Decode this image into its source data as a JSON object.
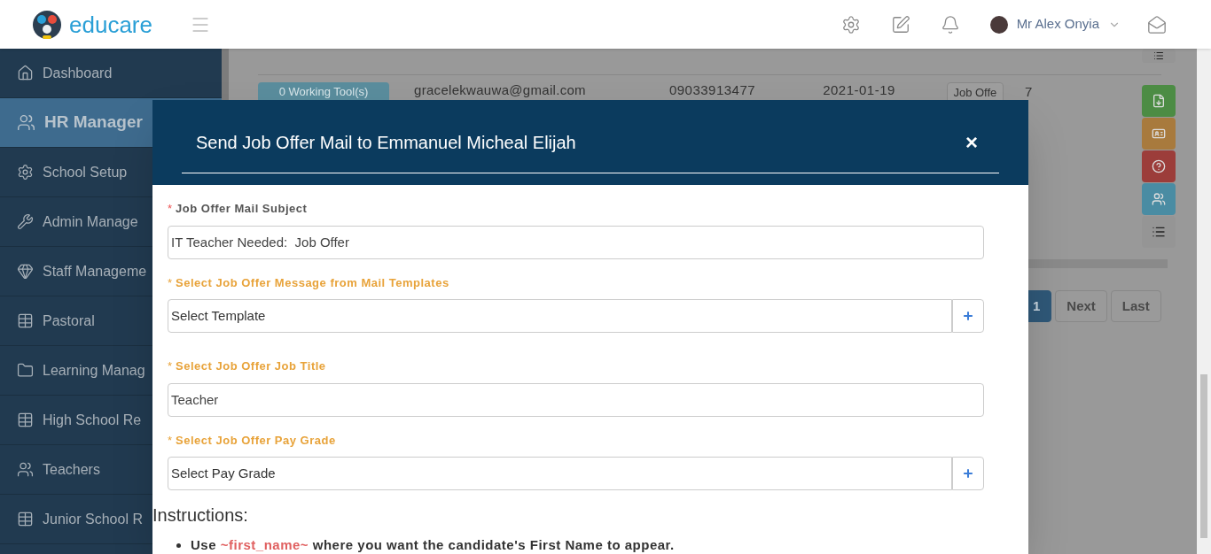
{
  "header": {
    "brand": "educare",
    "user": "Mr Alex Onyia"
  },
  "sidebar": {
    "items": [
      {
        "label": "Dashboard",
        "kind": "home",
        "selected": false
      },
      {
        "label": "HR Manager",
        "kind": "users",
        "selected": true
      },
      {
        "label": "School Setup",
        "kind": "gear",
        "selected": false
      },
      {
        "label": "Admin Manage",
        "kind": "wrench",
        "selected": false
      },
      {
        "label": "Staff Manageme",
        "kind": "diamond",
        "selected": false
      },
      {
        "label": "Pastoral",
        "kind": "grid",
        "selected": false
      },
      {
        "label": "Learning Manag",
        "kind": "folder",
        "selected": false
      },
      {
        "label": "High School Re",
        "kind": "grid",
        "selected": false
      },
      {
        "label": "Teachers",
        "kind": "users",
        "selected": false
      },
      {
        "label": "Junior School R",
        "kind": "grid",
        "selected": false
      }
    ]
  },
  "table_row": {
    "tools": "0 Working Tool(s)",
    "email": "gracelekwauwa@gmail.com",
    "phone": "09033913477",
    "date": "2021-01-19",
    "action": "Job Offe",
    "count": "7"
  },
  "side_actions": [
    {
      "kind": "list"
    },
    {
      "kind": "file",
      "color": "#4c8c44"
    },
    {
      "kind": "card",
      "color": "#a87a3d"
    },
    {
      "kind": "question",
      "color": "#9c3d3a"
    },
    {
      "kind": "users",
      "color": "#4a8ca3"
    },
    {
      "kind": "list"
    }
  ],
  "pagination": [
    {
      "label": "1",
      "selected": true
    },
    {
      "label": "Next",
      "selected": false
    },
    {
      "label": "Last",
      "selected": false
    }
  ],
  "modal": {
    "title": "Send Job Offer Mail to Emmanuel Micheal Elijah",
    "close": "×",
    "fields": [
      {
        "marker": "*",
        "label": "Job Offer Mail Subject",
        "highlighted": false,
        "kind": "input",
        "value": "IT Teacher Needed:  Job Offer"
      },
      {
        "marker": "*",
        "label": "Select Job Offer Message from Mail Templates",
        "highlighted": true,
        "kind": "select_add",
        "value": "Select Template"
      },
      {
        "marker": "*",
        "label": "Select Job Offer Job Title",
        "highlighted": true,
        "kind": "input",
        "value": "Teacher"
      },
      {
        "marker": "*",
        "label": "Select Job Offer Pay Grade",
        "highlighted": true,
        "kind": "select_add",
        "value": "Select Pay Grade"
      }
    ],
    "instructions_title": "Instructions:",
    "instructions": [
      {
        "before": "Use",
        "token": "~first_name~",
        "after": "where you want the candidate's First Name to appear."
      }
    ]
  }
}
